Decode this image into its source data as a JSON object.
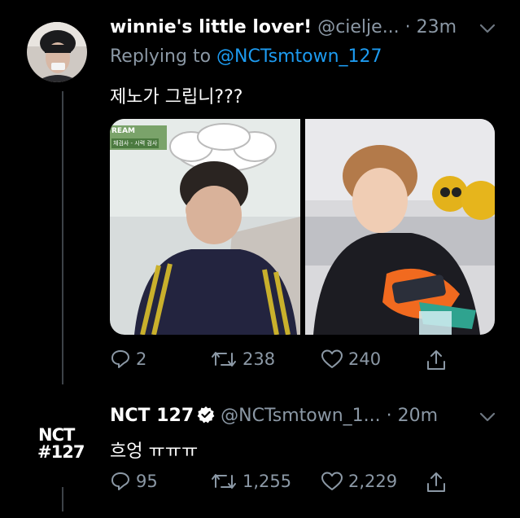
{
  "tweets": [
    {
      "display_name": "winnie's little lover!",
      "handle": "@cielje...",
      "time": "· 23m",
      "replying_prefix": "Replying to",
      "replying_to": "@NCTsmtown_127",
      "text": "제노가 그립니???",
      "media_caption_top": "REAM",
      "media_caption_sub": "체검사 - 시력 검사",
      "replies": "2",
      "retweets": "238",
      "likes": "240"
    },
    {
      "display_name": "NCT 127",
      "handle": "@NCTsmtown_1...",
      "time": "· 20m",
      "verified": true,
      "avatar_text_1": "NCT",
      "avatar_text_2": "#127",
      "text": "흐엉 ㅠㅠㅠ",
      "replies": "95",
      "retweets": "1,255",
      "likes": "2,229"
    }
  ],
  "colors": {
    "background": "#000000",
    "muted": "#8b98a5",
    "link": "#1d9bf0",
    "thread_line": "#3d4248"
  },
  "icons": [
    "reply-icon",
    "retweet-icon",
    "like-icon",
    "share-icon",
    "chevron-down-icon",
    "verified-icon"
  ]
}
